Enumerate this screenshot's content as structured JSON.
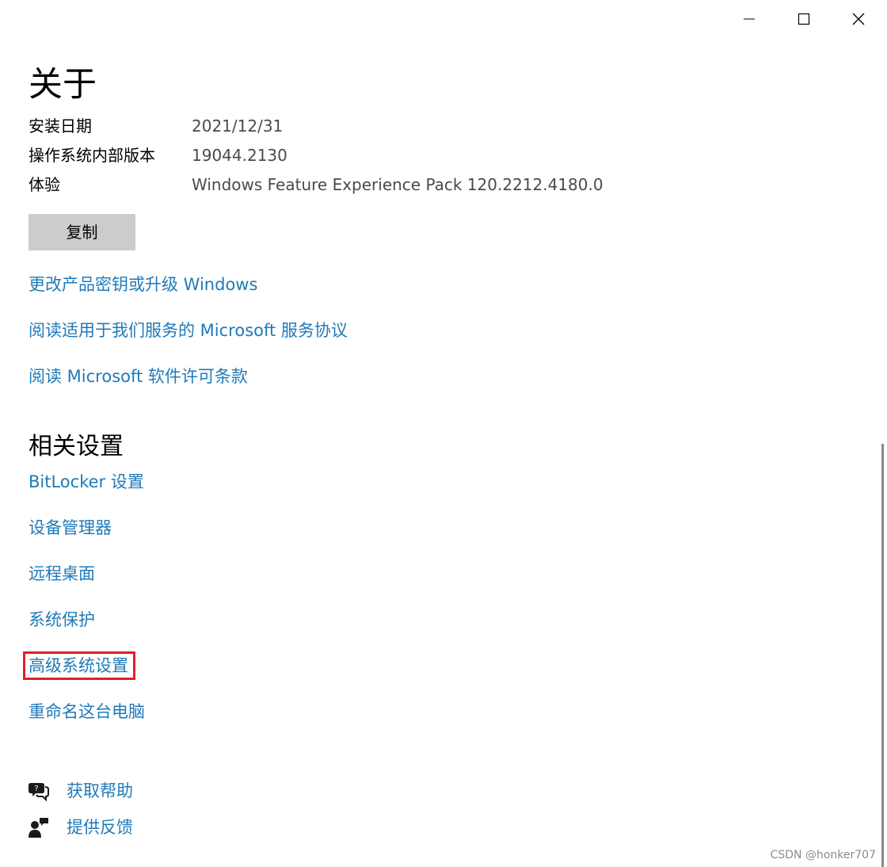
{
  "window_controls": {
    "minimize_icon": "minimize-icon",
    "maximize_icon": "maximize-icon",
    "close_icon": "close-icon"
  },
  "page": {
    "title": "关于"
  },
  "specifications": [
    {
      "label": "安装日期",
      "value": "2021/12/31"
    },
    {
      "label": "操作系统内部版本",
      "value": "19044.2130"
    },
    {
      "label": "体验",
      "value": "Windows Feature Experience Pack 120.2212.4180.0"
    }
  ],
  "copy_button": {
    "label": "复制"
  },
  "links": [
    "更改产品密钥或升级 Windows",
    "阅读适用于我们服务的 Microsoft 服务协议",
    "阅读 Microsoft 软件许可条款"
  ],
  "related_settings": {
    "title": "相关设置",
    "items": [
      "BitLocker 设置",
      "设备管理器",
      "远程桌面",
      "系统保护",
      "高级系统设置",
      "重命名这台电脑"
    ],
    "highlighted_item": "高级系统设置"
  },
  "help": [
    {
      "label": "获取帮助",
      "icon": "help-chat-icon"
    },
    {
      "label": "提供反馈",
      "icon": "feedback-icon"
    }
  ],
  "colors": {
    "link": "#1f7ab8",
    "button_bg": "#cccccc",
    "highlight_border": "#e0202a"
  },
  "watermark": "CSDN @honker707"
}
